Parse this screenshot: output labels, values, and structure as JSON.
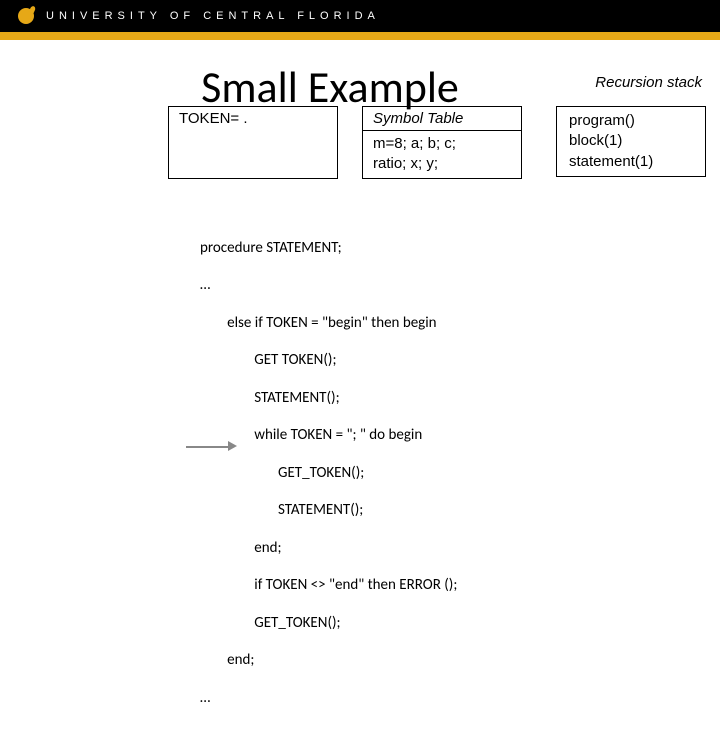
{
  "header": {
    "university": "UNIVERSITY OF CENTRAL FLORIDA"
  },
  "title": "Small Example",
  "recursion_label": "Recursion stack",
  "token_box": "TOKEN=  .",
  "symbol_table": {
    "heading": "Symbol Table",
    "line1": "m=8; a; b; c;",
    "line2": "ratio; x; y;"
  },
  "stack": {
    "line1": "program()",
    "line2": "block(1)",
    "line3": "statement(1)"
  },
  "code": {
    "l1": "procedure STATEMENT;",
    "l2": "…",
    "l3": "        else if TOKEN = \"begin\" then begin",
    "l4": "                GET TOKEN();",
    "l5": "                STATEMENT();",
    "l6": "                while TOKEN = \"; \" do begin",
    "l7": "                       GET_TOKEN();",
    "l8": "                       STATEMENT();",
    "l9": "                end;",
    "l10": "                if TOKEN <> \"end\" then ERROR ();",
    "l11": "                GET_TOKEN();",
    "l12": "        end;",
    "l13": "…"
  }
}
